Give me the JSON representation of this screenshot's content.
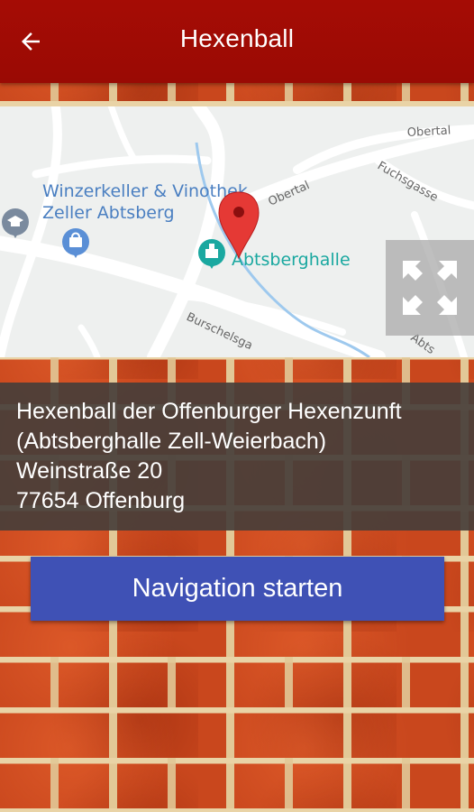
{
  "appbar": {
    "title": "Hexenball",
    "back_icon": "arrow-back-icon",
    "color": "#9a0a04"
  },
  "map": {
    "labels": {
      "poi_winzerkeller_line1": "Winzerkeller & Vinothek",
      "poi_winzerkeller_line2": "Zeller Abtsberg",
      "poi_abtsberghalle": "Abtsberghalle",
      "street_obertal_top": "Obertal",
      "street_obertal_mid": "Obertal",
      "street_fuchsgasse": "Fuchsgasse",
      "street_burschelsga": "Burschelsga",
      "street_abts": "Abts"
    },
    "marker_icon": "map-pin-icon",
    "fullscreen_icon": "fullscreen-expand-icon",
    "poi_label_color": "#4a7fc1"
  },
  "event": {
    "name": "Hexenball der Offenburger Hexenzunft",
    "venue": "(Abtsberghalle Zell-Weierbach)",
    "street": "Weinstraße 20",
    "city": "77654 Offenburg"
  },
  "navigation_button": {
    "label": "Navigation starten",
    "color": "#3f51b5"
  }
}
